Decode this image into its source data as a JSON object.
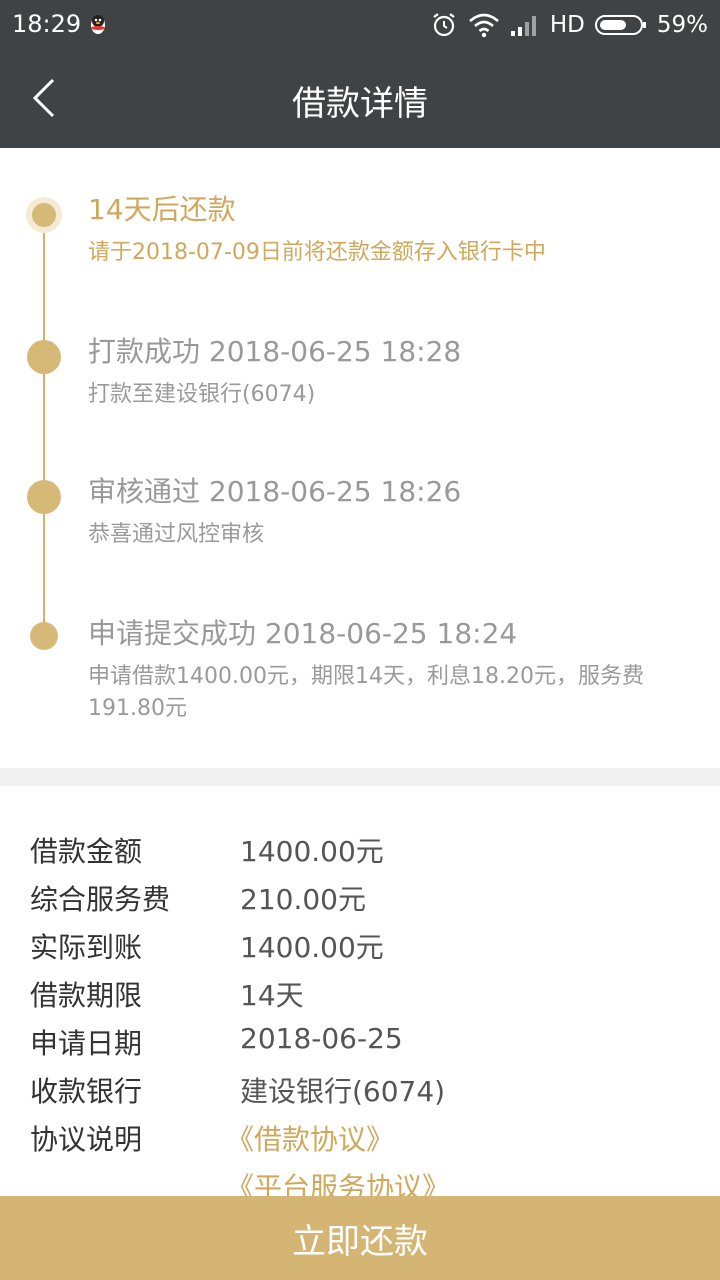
{
  "status_bar": {
    "time": "18:29",
    "network": "HD",
    "battery": "59%",
    "icons": [
      "qq-icon",
      "alarm-icon",
      "wifi-icon",
      "signal-icon",
      "battery-icon"
    ]
  },
  "nav": {
    "title": "借款详情",
    "back_icon": "chevron-left-icon"
  },
  "timeline": [
    {
      "title": "14天后还款",
      "subtitle": "请于2018-07-09日前将还款金额存入银行卡中",
      "active": true
    },
    {
      "title": "打款成功 2018-06-25 18:28",
      "subtitle": "打款至建设银行(6074)",
      "active": false
    },
    {
      "title": "审核通过 2018-06-25 18:26",
      "subtitle": "恭喜通过风控审核",
      "active": false
    },
    {
      "title": "申请提交成功 2018-06-25 18:24",
      "subtitle": "申请借款1400.00元，期限14天，利息18.20元，服务费191.80元",
      "active": false
    }
  ],
  "details": {
    "rows": [
      {
        "label": "借款金额",
        "value": "1400.00元"
      },
      {
        "label": "综合服务费",
        "value": "210.00元"
      },
      {
        "label": "实际到账",
        "value": "1400.00元"
      },
      {
        "label": "借款期限",
        "value": "14天"
      },
      {
        "label": "申请日期",
        "value": "2018-06-25"
      },
      {
        "label": "收款银行",
        "value": "建设银行(6074)"
      }
    ],
    "agreement_label": "协议说明",
    "agreements": [
      "《借款协议》",
      "《平台服务协议》"
    ]
  },
  "actions": {
    "repay_label": "立即还款"
  },
  "colors": {
    "header_bg": "#3f4346",
    "accent": "#d4b574",
    "accent_text": "#d0a85c"
  }
}
